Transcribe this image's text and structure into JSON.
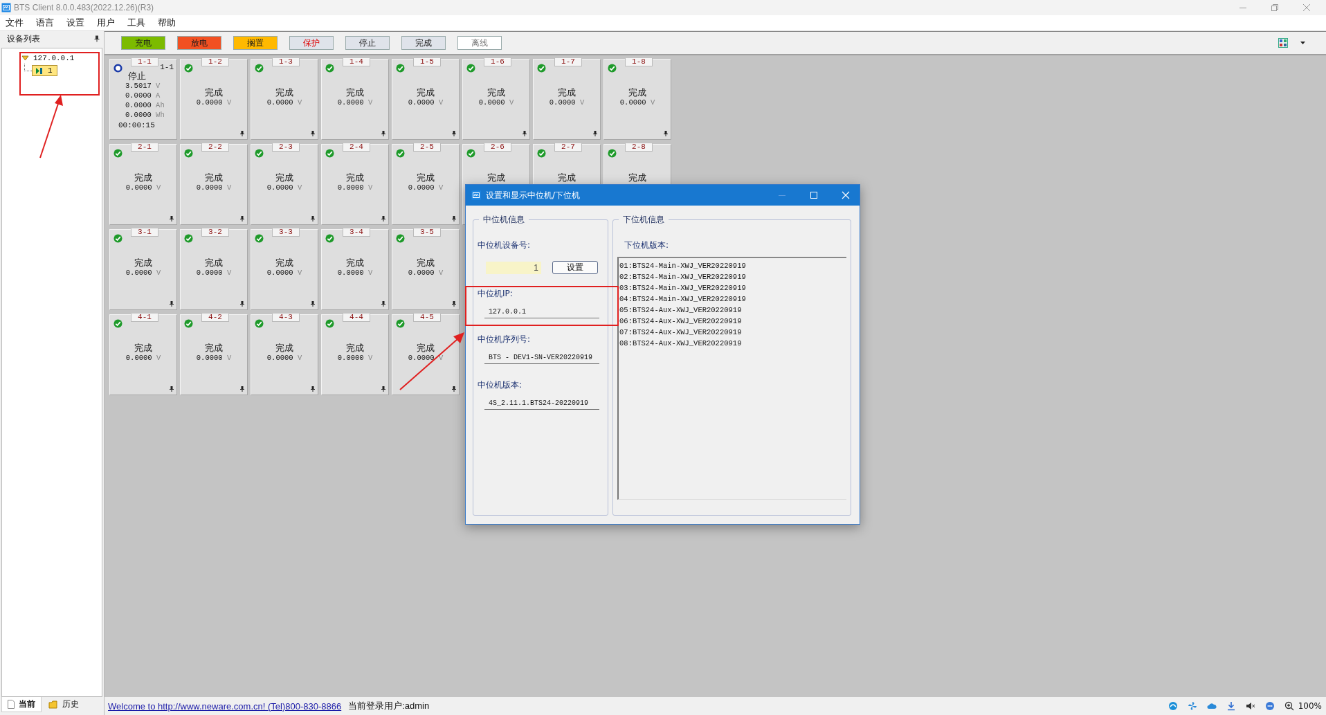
{
  "window": {
    "title": "BTS Client 8.0.0.483(2022.12.26)(R3)"
  },
  "menu": [
    "文件",
    "语言",
    "设置",
    "用户",
    "工具",
    "帮助"
  ],
  "device_panel": {
    "title": "设备列表",
    "tree": [
      {
        "label": "127.0.0.1",
        "expanded": true,
        "children": [
          {
            "label": "1",
            "selected": true
          }
        ]
      }
    ],
    "tabs": [
      {
        "label": "当前",
        "selected": true
      },
      {
        "label": "历史",
        "selected": false
      }
    ]
  },
  "legend": [
    {
      "label": "充电",
      "color": "#7cbb00",
      "kind": "normal"
    },
    {
      "label": "放电",
      "color": "#f25022",
      "kind": "normal"
    },
    {
      "label": "搁置",
      "color": "#ffb900",
      "kind": "normal"
    },
    {
      "label": "保护",
      "color": "#dfe3ea",
      "kind": "alert"
    },
    {
      "label": "停止",
      "color": "#dfe3ea",
      "kind": "normal"
    },
    {
      "label": "完成",
      "color": "#dfe3ea",
      "kind": "normal"
    },
    {
      "label": "离线",
      "color": "#ffffff",
      "kind": "muted"
    }
  ],
  "channels": [
    [
      {
        "label": "1-1",
        "kind": "stopped",
        "status": "停止",
        "corner": "1-1",
        "readings": [
          {
            "value": "3.5017",
            "unit": "V"
          },
          {
            "value": "0.0000",
            "unit": "A"
          },
          {
            "value": "0.0000",
            "unit": "Ah"
          },
          {
            "value": "0.0000",
            "unit": "Wh"
          }
        ],
        "time": "00:00:15"
      },
      {
        "label": "1-2",
        "kind": "done",
        "status": "完成",
        "readings": [
          {
            "value": "0.0000",
            "unit": "V"
          }
        ]
      },
      {
        "label": "1-3",
        "kind": "done",
        "status": "完成",
        "readings": [
          {
            "value": "0.0000",
            "unit": "V"
          }
        ]
      },
      {
        "label": "1-4",
        "kind": "done",
        "status": "完成",
        "readings": [
          {
            "value": "0.0000",
            "unit": "V"
          }
        ]
      },
      {
        "label": "1-5",
        "kind": "done",
        "status": "完成",
        "readings": [
          {
            "value": "0.0000",
            "unit": "V"
          }
        ]
      },
      {
        "label": "1-6",
        "kind": "done",
        "status": "完成",
        "readings": [
          {
            "value": "0.0000",
            "unit": "V"
          }
        ]
      },
      {
        "label": "1-7",
        "kind": "done",
        "status": "完成",
        "readings": [
          {
            "value": "0.0000",
            "unit": "V"
          }
        ]
      },
      {
        "label": "1-8",
        "kind": "done",
        "status": "完成",
        "readings": [
          {
            "value": "0.0000",
            "unit": "V"
          }
        ]
      }
    ],
    [
      {
        "label": "2-1",
        "kind": "done",
        "status": "完成",
        "readings": [
          {
            "value": "0.0000",
            "unit": "V"
          }
        ]
      },
      {
        "label": "2-2",
        "kind": "done",
        "status": "完成",
        "readings": [
          {
            "value": "0.0000",
            "unit": "V"
          }
        ]
      },
      {
        "label": "2-3",
        "kind": "done",
        "status": "完成",
        "readings": [
          {
            "value": "0.0000",
            "unit": "V"
          }
        ]
      },
      {
        "label": "2-4",
        "kind": "done",
        "status": "完成",
        "readings": [
          {
            "value": "0.0000",
            "unit": "V"
          }
        ]
      },
      {
        "label": "2-5",
        "kind": "done",
        "status": "完成",
        "readings": [
          {
            "value": "0.0000",
            "unit": "V"
          }
        ]
      },
      {
        "label": "2-6",
        "kind": "done",
        "status": "完成"
      },
      {
        "label": "2-7",
        "kind": "done",
        "status": "完成"
      },
      {
        "label": "2-8",
        "kind": "done",
        "status": "完成"
      }
    ],
    [
      {
        "label": "3-1",
        "kind": "done",
        "status": "完成",
        "readings": [
          {
            "value": "0.0000",
            "unit": "V"
          }
        ]
      },
      {
        "label": "3-2",
        "kind": "done",
        "status": "完成",
        "readings": [
          {
            "value": "0.0000",
            "unit": "V"
          }
        ]
      },
      {
        "label": "3-3",
        "kind": "done",
        "status": "完成",
        "readings": [
          {
            "value": "0.0000",
            "unit": "V"
          }
        ]
      },
      {
        "label": "3-4",
        "kind": "done",
        "status": "完成",
        "readings": [
          {
            "value": "0.0000",
            "unit": "V"
          }
        ]
      },
      {
        "label": "3-5",
        "kind": "done",
        "status": "完成",
        "readings": [
          {
            "value": "0.0000",
            "unit": "V"
          }
        ]
      }
    ],
    [
      {
        "label": "4-1",
        "kind": "done",
        "status": "完成",
        "readings": [
          {
            "value": "0.0000",
            "unit": "V"
          }
        ]
      },
      {
        "label": "4-2",
        "kind": "done",
        "status": "完成",
        "readings": [
          {
            "value": "0.0000",
            "unit": "V"
          }
        ]
      },
      {
        "label": "4-3",
        "kind": "done",
        "status": "完成",
        "readings": [
          {
            "value": "0.0000",
            "unit": "V"
          }
        ]
      },
      {
        "label": "4-4",
        "kind": "done",
        "status": "完成",
        "readings": [
          {
            "value": "0.0000",
            "unit": "V"
          }
        ]
      },
      {
        "label": "4-5",
        "kind": "done",
        "status": "完成",
        "readings": [
          {
            "value": "0.0000",
            "unit": "V"
          }
        ]
      }
    ]
  ],
  "dialog": {
    "title": "设置和显示中位机/下位机",
    "middle_group": {
      "title": "中位机信息",
      "device_no": {
        "label": "中位机设备号:",
        "value": "1",
        "button": "设置"
      },
      "fields": [
        {
          "label": "中位机IP:",
          "value": "127.0.0.1"
        },
        {
          "label": "中位机序列号:",
          "value": "BTS - DEV1-SN-VER20220919"
        },
        {
          "label": "中位机版本:",
          "value": "4S_2.11.1.BTS24-20220919"
        }
      ]
    },
    "lower_group": {
      "title": "下位机信息",
      "label": "下位机版本:",
      "versions": [
        "01:BTS24-Main-XWJ_VER20220919",
        "02:BTS24-Main-XWJ_VER20220919",
        "03:BTS24-Main-XWJ_VER20220919",
        "04:BTS24-Main-XWJ_VER20220919",
        "05:BTS24-Aux-XWJ_VER20220919",
        "06:BTS24-Aux-XWJ_VER20220919",
        "07:BTS24-Aux-XWJ_VER20220919",
        "08:BTS24-Aux-XWJ_VER20220919"
      ]
    }
  },
  "status_bar": {
    "link": "Welcome to http://www.neware.com.cn! (Tel)800-830-8866",
    "user": "当前登录用户:admin",
    "zoom": "100%"
  }
}
